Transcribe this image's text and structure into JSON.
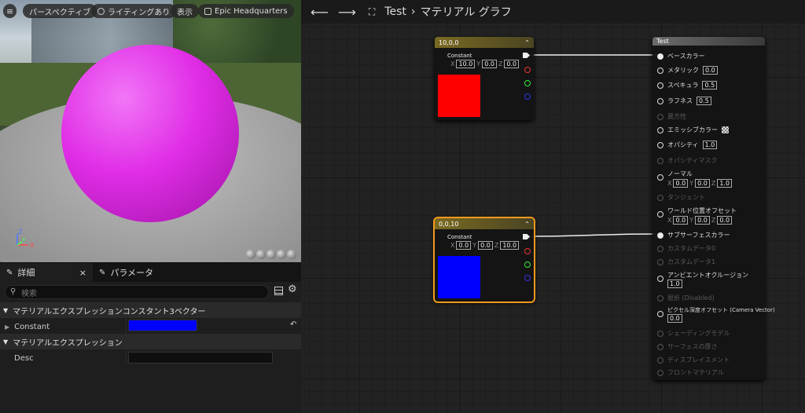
{
  "viewport": {
    "menu_icon": "hamburger-icon",
    "perspective": "パースペクティブ",
    "lighting": "ライティングあり",
    "show": "表示",
    "level": "Epic Headquarters",
    "axis": {
      "x": "X",
      "y": "Y",
      "z": "Z"
    },
    "sphere_color": "#e02de6"
  },
  "details": {
    "tab_details": "詳細",
    "tab_close": "×",
    "tab_params": "パラメータ",
    "search_placeholder": "検索",
    "category1": "マテリアルエクスプレッションコンスタント3ベクター",
    "prop_constant": "Constant",
    "constant_color": "#0000ff",
    "category2": "マテリアルエクスプレッション",
    "prop_desc": "Desc"
  },
  "graph": {
    "breadcrumb_root": "Test",
    "breadcrumb_sep": "›",
    "breadcrumb_current": "マテリアル グラフ",
    "node_red": {
      "title": "10,0,0",
      "label": "Constant",
      "x": "10.0",
      "y": "0.0",
      "z": "0.0",
      "color": "#ff0000"
    },
    "node_blue": {
      "title": "0,0,10",
      "label": "Constant",
      "x": "0.0",
      "y": "0.0",
      "z": "10.0",
      "color": "#0000ff"
    },
    "axis_x": "X",
    "axis_y": "Y",
    "axis_z": "Z",
    "result": {
      "title": "Test",
      "base_color": "ベースカラー",
      "metallic": "メタリック",
      "metallic_val": "0.0",
      "specular": "スペキュラ",
      "specular_val": "0.5",
      "roughness": "ラフネス",
      "roughness_val": "0.5",
      "anisotropy": "異方性",
      "emissive": "エミッシブカラー",
      "opacity": "オパシティ",
      "opacity_val": "1.0",
      "opacity_mask": "オパシティマスク",
      "normal": "ノーマル",
      "normal_x": "0.0",
      "normal_y": "0.0",
      "normal_z": "1.0",
      "tangent": "タンジェント",
      "wpo": "ワールド位置オフセット",
      "wpo_x": "0.0",
      "wpo_y": "0.0",
      "wpo_z": "0.0",
      "subsurface": "サブサーフェスカラー",
      "custom0": "カスタムデータ0",
      "custom1": "カスタムデータ1",
      "ao": "アンビエントオクルージョン",
      "ao_val": "1.0",
      "refraction": "屈折 (Disabled)",
      "pdo": "ピクセル深度オフセット (Camera Vector)",
      "pdo_val": "0.0",
      "shading_model": "シェーディングモデル",
      "surface_thickness": "サーフェスの厚さ",
      "displacement": "ディスプレイスメント",
      "front_material": "フロントマテリアル"
    }
  }
}
